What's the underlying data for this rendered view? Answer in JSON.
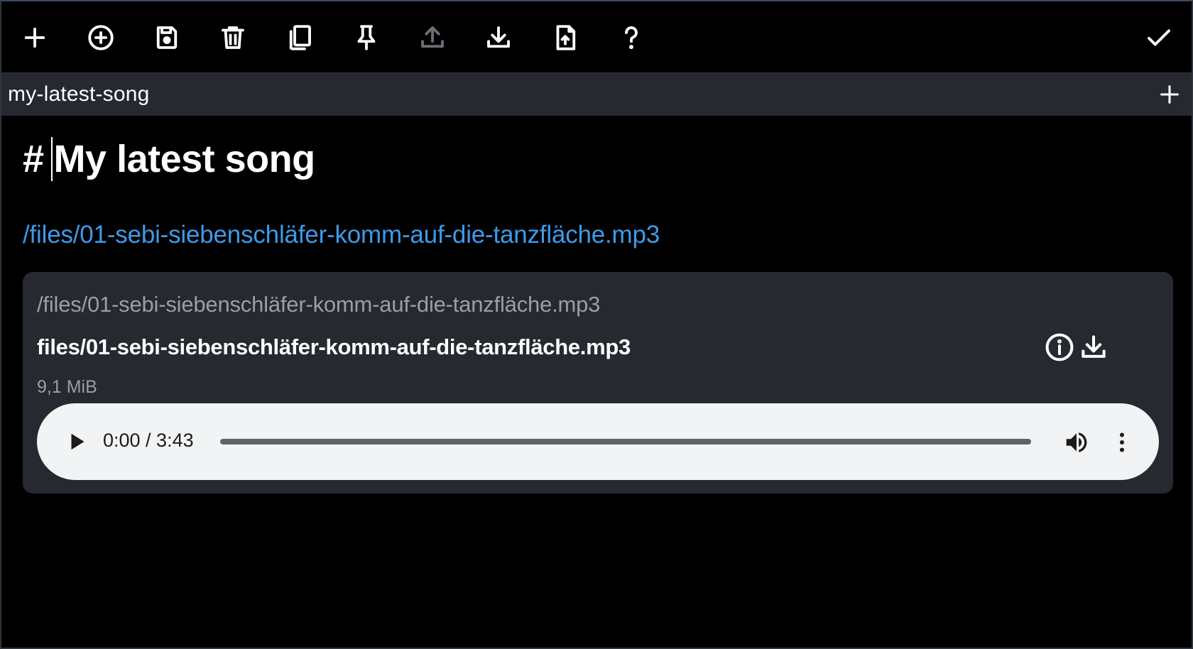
{
  "toolbar": {
    "buttons": [
      {
        "name": "new-note-button",
        "icon": "plus-icon",
        "enabled": true
      },
      {
        "name": "new-item-button",
        "icon": "plus-circle-icon",
        "enabled": true
      },
      {
        "name": "save-button",
        "icon": "save-icon",
        "enabled": true
      },
      {
        "name": "delete-button",
        "icon": "trash-icon",
        "enabled": true
      },
      {
        "name": "duplicate-button",
        "icon": "copy-icon",
        "enabled": true
      },
      {
        "name": "pin-button",
        "icon": "pin-icon",
        "enabled": true
      },
      {
        "name": "upload-button",
        "icon": "upload-icon",
        "enabled": false
      },
      {
        "name": "download-button",
        "icon": "download-icon",
        "enabled": true
      },
      {
        "name": "export-file-button",
        "icon": "file-upload-icon",
        "enabled": true
      },
      {
        "name": "help-button",
        "icon": "question-icon",
        "enabled": true
      },
      {
        "name": "done-button",
        "icon": "check-icon",
        "enabled": true
      }
    ]
  },
  "tab": {
    "title": "my-latest-song",
    "add_icon": "plus-icon"
  },
  "editor": {
    "heading_marker": "#",
    "heading_text": "My latest song",
    "link_text": "/files/01-sebi-siebenschläfer-komm-auf-die-tanzfläche.mp3"
  },
  "embed": {
    "path": "/files/01-sebi-siebenschläfer-komm-auf-die-tanzfläche.mp3",
    "name": "files/01-sebi-siebenschläfer-komm-auf-die-tanzfläche.mp3",
    "size": "9,1 MiB",
    "info_icon": "info-icon",
    "download_icon": "download-icon"
  },
  "player": {
    "time": "0:00 / 3:43",
    "progress": 0,
    "icons": [
      "play-icon",
      "volume-icon",
      "more-vertical-icon"
    ]
  },
  "colors": {
    "background": "#000000",
    "tabbar": "#26292f",
    "link": "#3e9ae8",
    "player_bg": "#f1f3f4",
    "muted_text": "#9b9ea4"
  }
}
